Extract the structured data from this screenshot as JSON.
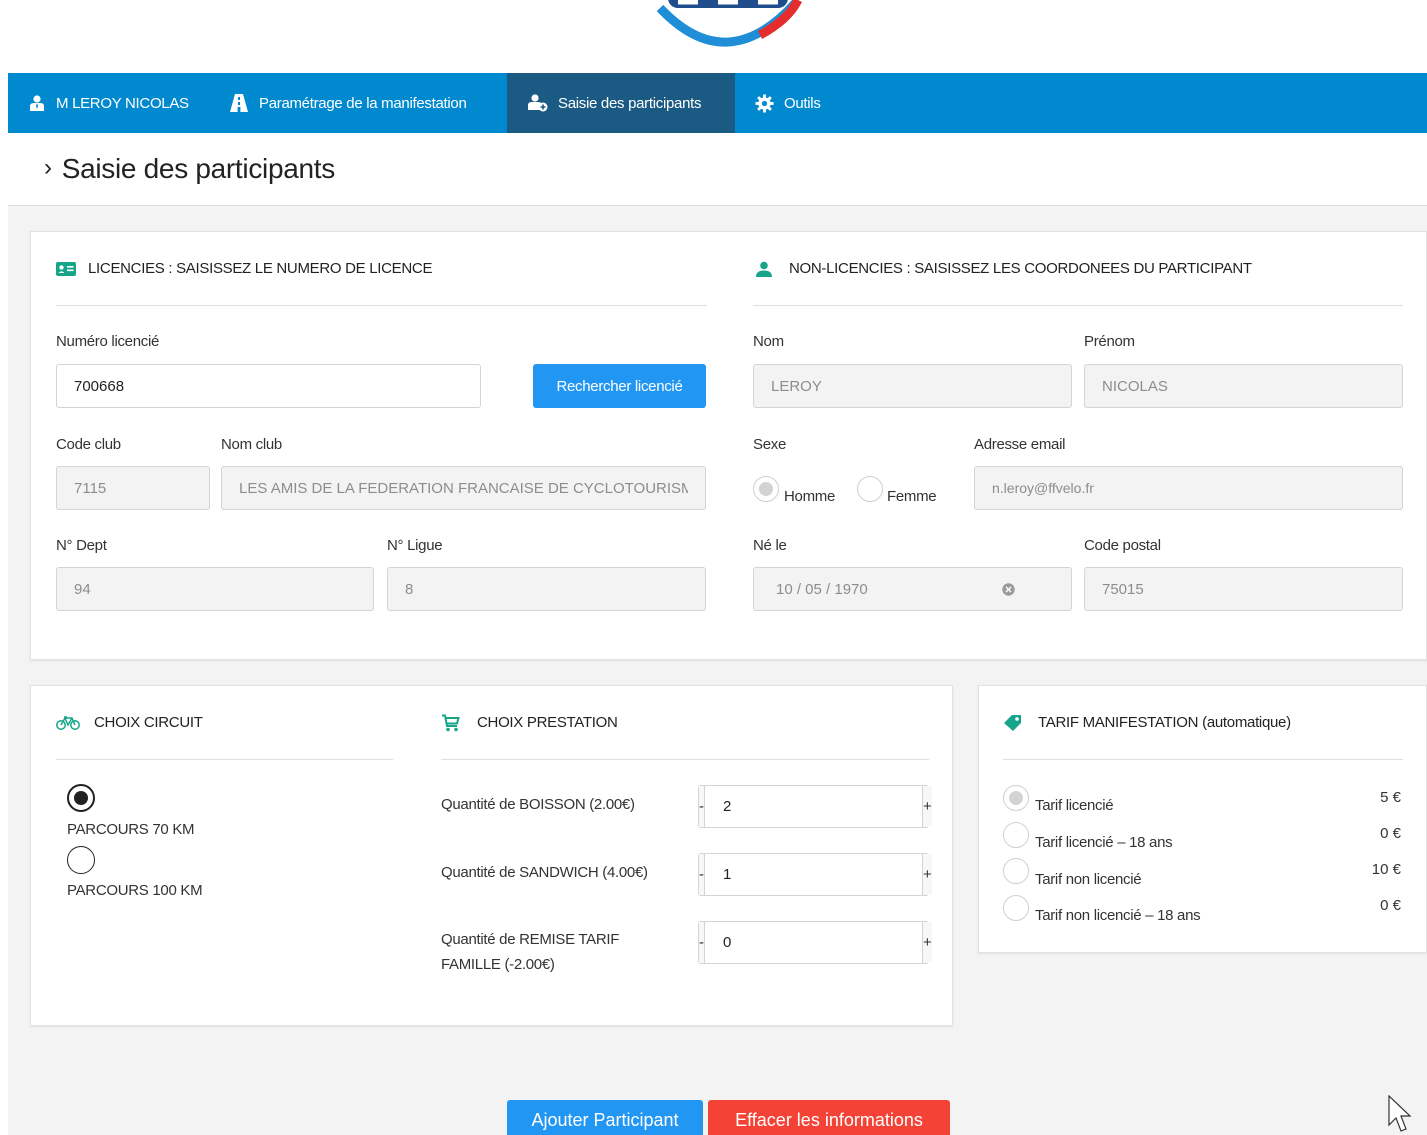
{
  "navbar": {
    "items": [
      {
        "label": "M LEROY NICOLAS",
        "icon": "user-icon"
      },
      {
        "label": "Paramétrage de la manifestation",
        "icon": "road-icon"
      },
      {
        "label": "Saisie des participants",
        "icon": "user-plus-icon"
      },
      {
        "label": "Outils",
        "icon": "gear-icon"
      }
    ],
    "active_index": 2,
    "color": "#0089cf",
    "active_color": "#1b5a83"
  },
  "page": {
    "title": "Saisie des participants"
  },
  "licencies": {
    "heading": "LICENCIES : SAISISSEZ LE NUMERO DE LICENCE",
    "numero_label": "Numéro licencié",
    "numero_value": "700668",
    "search_button": "Rechercher licencié",
    "code_club_label": "Code club",
    "code_club_value": "7115",
    "nom_club_label": "Nom club",
    "nom_club_value": "LES AMIS DE LA FEDERATION FRANCAISE DE CYCLOTOURISME",
    "dept_label": "N° Dept",
    "dept_value": "94",
    "ligue_label": "N° Ligue",
    "ligue_value": "8"
  },
  "non_licencies": {
    "heading": "NON-LICENCIES : SAISISSEZ LES COORDONEES DU PARTICIPANT",
    "nom_label": "Nom",
    "nom_value": "LEROY",
    "prenom_label": "Prénom",
    "prenom_value": "NICOLAS",
    "sexe_label": "Sexe",
    "sexe_options": [
      "Homme",
      "Femme"
    ],
    "sexe_selected": "Homme",
    "email_label": "Adresse email",
    "email_value": "n.leroy@ffvelo.fr",
    "ne_le_label": "Né le",
    "ne_le_value": "10 / 05 / 1970",
    "cp_label": "Code postal",
    "cp_value": "75015"
  },
  "circuit": {
    "heading": "CHOIX CIRCUIT",
    "options": [
      "PARCOURS 70 KM",
      "PARCOURS 100 KM"
    ],
    "selected": "PARCOURS 70 KM"
  },
  "prestation": {
    "heading": "CHOIX PRESTATION",
    "items": [
      {
        "label": "Quantité de BOISSON (2.00€)",
        "value": "2"
      },
      {
        "label": "Quantité de SANDWICH (4.00€)",
        "value": "1"
      },
      {
        "label_line1": "Quantité de REMISE TARIF",
        "label_line2": "FAMILLE (-2.00€)",
        "value": "0"
      }
    ],
    "minus": "-",
    "plus": "+"
  },
  "tarif": {
    "heading": "TARIF MANIFESTATION",
    "heading_suffix": "(automatique)",
    "items": [
      {
        "label": "Tarif licencié",
        "price": "5 €"
      },
      {
        "label": "Tarif licencié – 18 ans",
        "price": "0 €"
      },
      {
        "label": "Tarif non licencié",
        "price": "10 €"
      },
      {
        "label": "Tarif non licencié – 18 ans",
        "price": "0 €"
      }
    ],
    "selected_index": 0
  },
  "actions": {
    "add": "Ajouter Participant",
    "clear": "Effacer les informations",
    "add_color": "#2196f3",
    "clear_color": "#f44336"
  },
  "colors": {
    "accent": "#2196f3",
    "icon_green": "#17a589"
  }
}
